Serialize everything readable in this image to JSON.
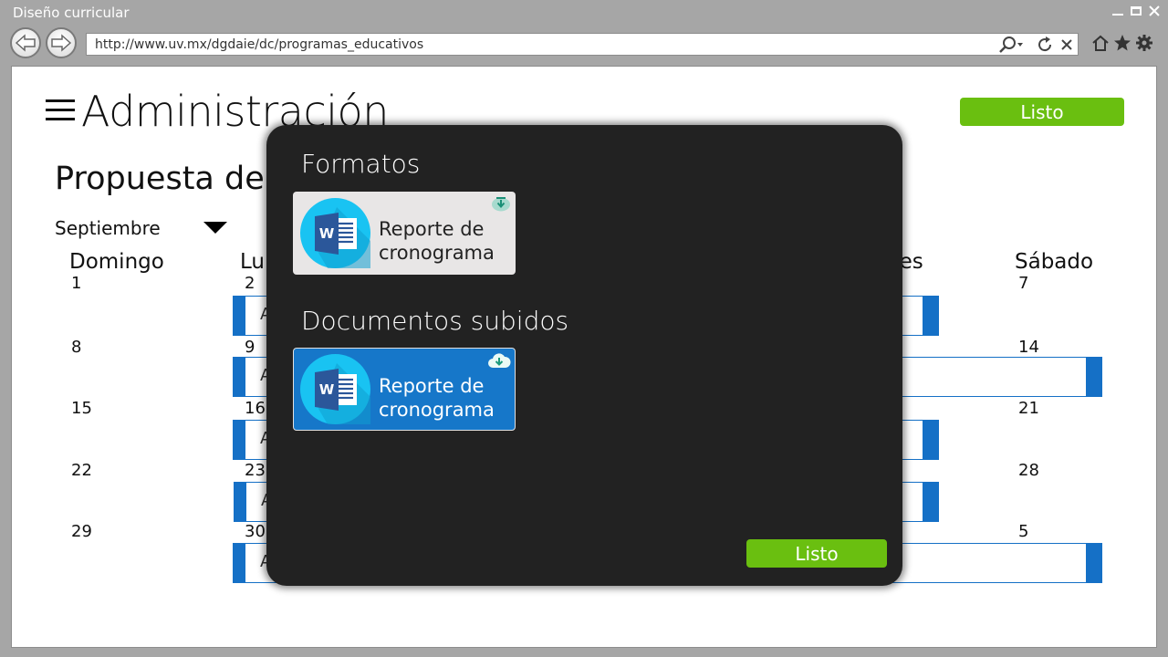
{
  "window": {
    "title": "Diseño curricular",
    "url": "http://www.uv.mx/dgdaie/dc/programas_educativos"
  },
  "header": {
    "title": "Administración",
    "done_label": "Listo"
  },
  "calendar": {
    "subtitle": "Propuesta de t",
    "month": "Septiembre",
    "days": [
      "Domingo",
      "Lu",
      "nes",
      "Sábado"
    ],
    "weeks": [
      {
        "sun": "1",
        "mon": "2",
        "sat": "7",
        "event_text": "A"
      },
      {
        "sun": "8",
        "mon": "9",
        "sat": "14",
        "event_text": "A"
      },
      {
        "sun": "15",
        "mon": "16",
        "sat": "21",
        "event_text": "A"
      },
      {
        "sun": "22",
        "mon": "23",
        "sat": "28",
        "event_text": "A"
      },
      {
        "sun": "29",
        "mon": "30",
        "sat": "5",
        "event_text": "A"
      }
    ]
  },
  "modal": {
    "formats_heading": "Formatos",
    "uploaded_heading": "Documentos subidos",
    "format_file": {
      "line1": "Reporte de",
      "line2": "cronograma",
      "icon": "download-icon"
    },
    "uploaded_file": {
      "line1": "Reporte de",
      "line2": "cronograma",
      "icon": "cloud-upload-icon"
    },
    "done_label": "Listo"
  },
  "colors": {
    "accent_green": "#6abf10",
    "accent_blue": "#1570c6",
    "modal_bg": "#222222",
    "word_badge": "#19c3f2"
  }
}
